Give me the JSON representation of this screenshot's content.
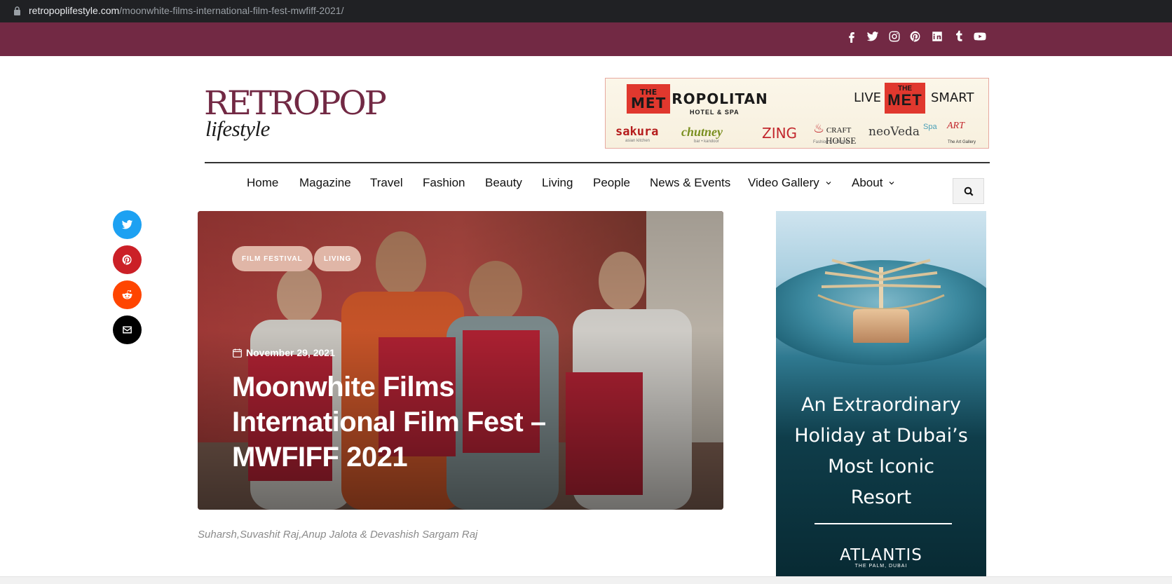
{
  "browser": {
    "url_host": "retropoplifestyle.com",
    "url_path": "/moonwhite-films-international-film-fest-mwfiff-2021/"
  },
  "colors": {
    "topbar": "#722944",
    "twitter": "#1da1f2",
    "pinterest": "#cb2027",
    "reddit": "#ff4500",
    "email": "#000000",
    "category_pill": "#e0b6a7"
  },
  "social_icons": [
    "facebook-icon",
    "twitter-icon",
    "instagram-icon",
    "pinterest-icon",
    "linkedin-icon",
    "tumblr-icon",
    "youtube-icon"
  ],
  "logo": {
    "line1": "RETROPOP",
    "line2": "lifestyle"
  },
  "header_ad": {
    "the": "THE",
    "met_prefix": "MET",
    "met_rest": "ROPOLITAN",
    "hotel": "HOTEL & SPA",
    "live": "LIVE",
    "met_badge_top": "THE",
    "met_badge": "MET",
    "smart": "SMART",
    "brands": {
      "sakura": "sakura",
      "sakura_sub": "asian kitchen",
      "chutney": "chutney",
      "chutney_sub": "bar • kandoor",
      "zing": "ZING",
      "craft_top": "CRAFT",
      "craft_bottom": "HOUSE",
      "craft_sub": "Fashion & Lifestyle",
      "neoveda": "neoVeda",
      "spa": "Spa",
      "art": "ART",
      "art_sub": "The Art Gallery"
    }
  },
  "nav": {
    "items": [
      {
        "label": "Home"
      },
      {
        "label": "Magazine"
      },
      {
        "label": "Travel"
      },
      {
        "label": "Fashion"
      },
      {
        "label": "Beauty"
      },
      {
        "label": "Living"
      },
      {
        "label": "People"
      },
      {
        "label": "News & Events"
      },
      {
        "label": "Video Gallery"
      },
      {
        "label": "About"
      }
    ]
  },
  "share_icons": [
    "twitter-icon",
    "pinterest-icon",
    "reddit-icon",
    "email-icon"
  ],
  "article": {
    "categories": [
      "FILM FESTIVAL",
      "LIVING"
    ],
    "date": "November 29, 2021",
    "title": "Moonwhite Films International Film Fest – MWFIFF 2021",
    "caption": "Suharsh,Suvashit Raj,Anup Jalota & Devashish Sargam Raj"
  },
  "side_ad": {
    "tagline_lines": [
      "An Extraordinary",
      "Holiday at Dubai’s",
      "Most Iconic",
      "Resort"
    ],
    "brand": "ATLANTIS",
    "location": "THE PALM, DUBAI"
  }
}
